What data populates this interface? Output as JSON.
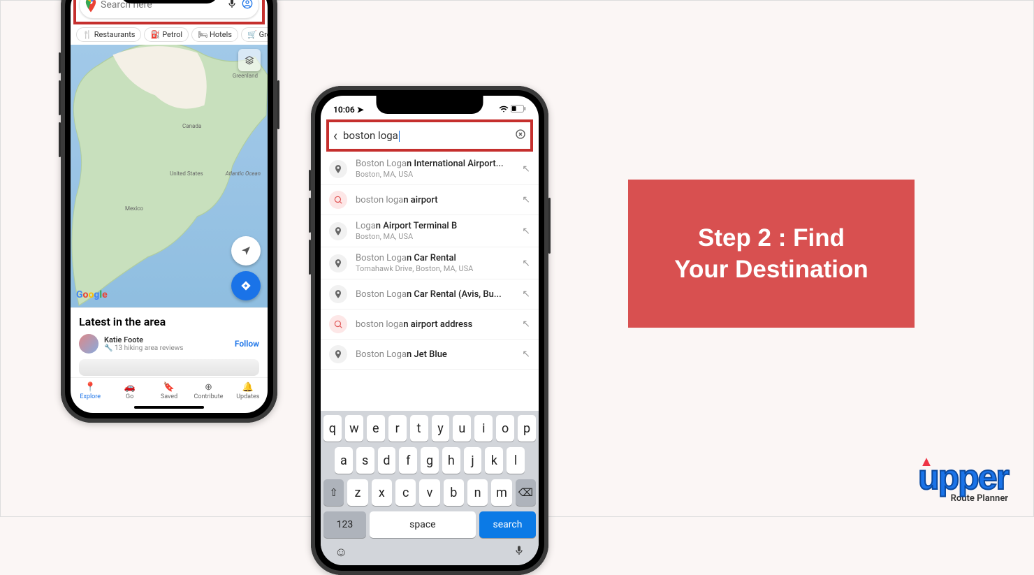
{
  "step_card": {
    "line1": "Step 2 : Find",
    "line2": "Your Destination"
  },
  "brand": {
    "name": "upper",
    "tagline": "Route Planner"
  },
  "phone1": {
    "search_placeholder": "Search here",
    "chips": [
      "Restaurants",
      "Petrol",
      "Hotels",
      "Gro"
    ],
    "map_labels": {
      "greenland": "Greenland",
      "canada": "Canada",
      "united_states": "United States",
      "mexico": "Mexico",
      "atlantic": "Atlantic Ocean"
    },
    "google": "Google",
    "sheet_title": "Latest in the area",
    "user": {
      "name": "Katie Foote",
      "sub": "13 hiking area reviews",
      "follow_label": "Follow"
    },
    "nav": [
      "Explore",
      "Go",
      "Saved",
      "Contribute",
      "Updates"
    ]
  },
  "phone2": {
    "time": "10:06",
    "query": "boston loga",
    "suggestions": [
      {
        "icon": "pin",
        "t1_pre": "Boston Loga",
        "t1_bold": "n International Airport...",
        "t2": "Boston, MA, USA"
      },
      {
        "icon": "search",
        "t1_pre": "boston loga",
        "t1_bold": "n airport",
        "t2": ""
      },
      {
        "icon": "pin",
        "t1_pre": "Loga",
        "t1_bold": "n Airport Terminal B",
        "t2": "Boston, MA, USA"
      },
      {
        "icon": "pin",
        "t1_pre": "Boston Loga",
        "t1_bold": "n Car Rental",
        "t2": "Tomahawk Drive, Boston, MA, USA"
      },
      {
        "icon": "pin",
        "t1_pre": "Boston Loga",
        "t1_bold": "n Car Rental (Avis, Bu...",
        "t2": ""
      },
      {
        "icon": "search",
        "t1_pre": "boston loga",
        "t1_bold": "n airport address",
        "t2": ""
      },
      {
        "icon": "pin",
        "t1_pre": "Boston Loga",
        "t1_bold": "n Jet Blue",
        "t2": ""
      }
    ],
    "keyboard": {
      "row1": [
        "q",
        "w",
        "e",
        "r",
        "t",
        "y",
        "u",
        "i",
        "o",
        "p"
      ],
      "row2": [
        "a",
        "s",
        "d",
        "f",
        "g",
        "h",
        "j",
        "k",
        "l"
      ],
      "row3": [
        "z",
        "x",
        "c",
        "v",
        "b",
        "n",
        "m"
      ],
      "num": "123",
      "space": "space",
      "search": "search"
    }
  }
}
